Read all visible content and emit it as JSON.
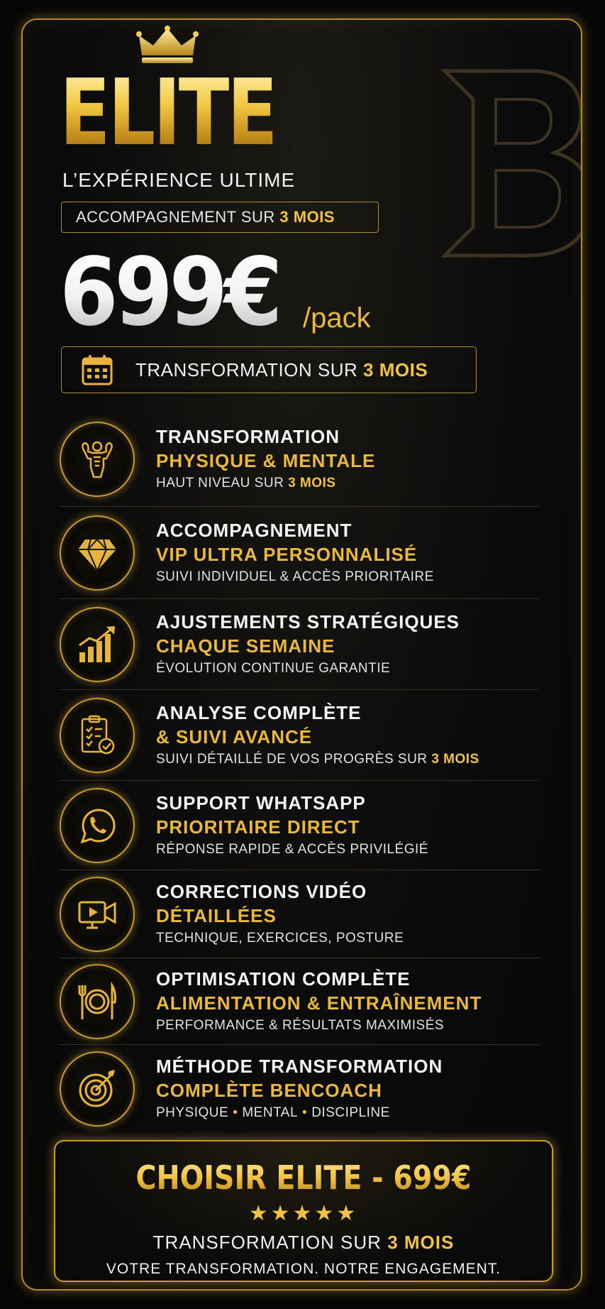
{
  "header": {
    "title": "ELITE",
    "subtitle": "L’EXPÉRIENCE ULTIME",
    "accompaniment_prefix": "ACCOMPAGNEMENT SUR",
    "accompaniment_highlight": "3 MOIS",
    "price": "699€",
    "price_unit": "/pack",
    "transformation_prefix": "TRANSFORMATION SUR",
    "transformation_highlight": "3 MOIS"
  },
  "features": [
    {
      "icon": "muscle-icon",
      "line1": "TRANSFORMATION",
      "line2": "PHYSIQUE & MENTALE",
      "line3": "HAUT NIVEAU SUR",
      "line3_highlight": "3 MOIS"
    },
    {
      "icon": "diamond-icon",
      "line1": "ACCOMPAGNEMENT",
      "line2": "VIP ULTRA PERSONNALISÉ",
      "line3": "SUIVI INDIVIDUEL & ACCÈS PRIORITAIRE",
      "line3_highlight": ""
    },
    {
      "icon": "chart-growth-icon",
      "line1": "AJUSTEMENTS STRATÉGIQUES",
      "line2": "CHAQUE SEMAINE",
      "line3": "ÉVOLUTION CONTINUE GARANTIE",
      "line3_highlight": ""
    },
    {
      "icon": "clipboard-check-icon",
      "line1": "ANALYSE COMPLÈTE",
      "line2": "& SUIVI AVANCÉ",
      "line3": "SUIVI DÉTAILLÉ DE VOS PROGRÈS SUR",
      "line3_highlight": "3 MOIS"
    },
    {
      "icon": "whatsapp-icon",
      "line1": "SUPPORT WHATSAPP",
      "line2": "PRIORITAIRE DIRECT",
      "line3": "RÉPONSE RAPIDE & ACCÈS PRIVILÉGIÉ",
      "line3_highlight": ""
    },
    {
      "icon": "video-camera-icon",
      "line1": "CORRECTIONS VIDÉO",
      "line2": "DÉTAILLÉES",
      "line3": "TECHNIQUE, EXERCICES, POSTURE",
      "line3_highlight": ""
    },
    {
      "icon": "plate-cutlery-icon",
      "line1": "OPTIMISATION COMPLÈTE",
      "line2": "ALIMENTATION & ENTRAÎNEMENT",
      "line3": "PERFORMANCE & RÉSULTATS MAXIMISÉS",
      "line3_highlight": ""
    },
    {
      "icon": "target-icon",
      "line1": "MÉTHODE TRANSFORMATION",
      "line2": "COMPLÈTE BENCOACH",
      "line3_parts": [
        "PHYSIQUE",
        "MENTAL",
        "DISCIPLINE"
      ]
    }
  ],
  "cta": {
    "title": "CHOISIR ELITE - 699€",
    "stars": "★★★★★",
    "rating": 5,
    "subtitle_prefix": "TRANSFORMATION SUR",
    "subtitle_highlight": "3 MOIS",
    "tagline": "VOTRE TRANSFORMATION. NOTRE ENGAGEMENT."
  },
  "colors": {
    "gold": "#f0c245",
    "gold_dark": "#b08a2c",
    "background": "#050505"
  }
}
